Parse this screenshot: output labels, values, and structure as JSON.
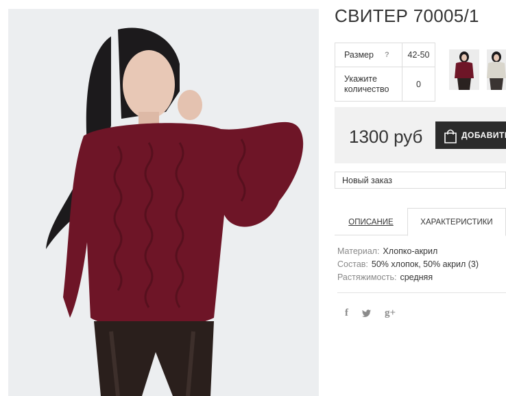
{
  "product": {
    "title": "СВИТЕР 70005/1",
    "price": "1300 руб"
  },
  "options": {
    "size_label": "Размер",
    "size_help": "?",
    "size_value": "42-50",
    "qty_label": "Укажите количество",
    "qty_value": "0"
  },
  "buy_button": {
    "label": "ДОБАВИТЬ",
    "icon": "shopping-bag-icon"
  },
  "order_select": {
    "selected": "Новый заказ"
  },
  "tabs": [
    {
      "label": "ОПИСАНИЕ",
      "active": false
    },
    {
      "label": "ХАРАКТЕРИСТИКИ",
      "active": true
    }
  ],
  "specs": [
    {
      "key": "Материал:",
      "value": "Хлопко-акрил"
    },
    {
      "key": "Состав:",
      "value": "50% хлопок, 50% акрил (3)"
    },
    {
      "key": "Растяжимость:",
      "value": "средняя"
    }
  ],
  "social": [
    {
      "name": "facebook-icon",
      "glyph": "f"
    },
    {
      "name": "twitter-icon",
      "glyph": ""
    },
    {
      "name": "google-plus-icon",
      "glyph": "g+"
    }
  ],
  "colors": {
    "sweater": "#6e1527",
    "price_bg": "#f1f1f1",
    "button_bg": "#2b2b2b"
  }
}
